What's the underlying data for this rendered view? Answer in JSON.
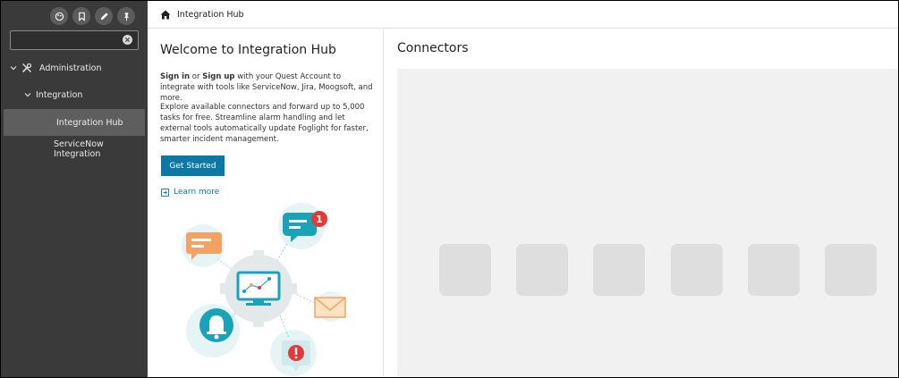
{
  "sidebar": {
    "icons": [
      "palette-icon",
      "bookmark-icon",
      "pencil-icon",
      "pin-icon"
    ],
    "search": {
      "value": "",
      "placeholder": ""
    },
    "nav": {
      "administration": "Administration",
      "integration": "Integration",
      "integration_hub": "Integration Hub",
      "servicenow": "ServiceNow Integration"
    }
  },
  "breadcrumb": {
    "label": "Integration Hub"
  },
  "welcome": {
    "title": "Welcome to Integration Hub",
    "sign_in": "Sign in",
    "or": " or ",
    "sign_up": "Sign up",
    "p1_rest": " with your Quest Account to integrate with tools like ServiceNow, Jira, Moogsoft, and more.",
    "p2": "Explore available connectors and forward up to 5,000 tasks for free. Streamline alarm handling and let external tools automatically update Foglight for faster, smarter incident management.",
    "button": "Get Started",
    "learn_more": "Learn more",
    "notification_count": "1"
  },
  "connectors": {
    "title": "Connectors"
  },
  "colors": {
    "sidebar_bg": "#3a3a3a",
    "selected_bg": "#5e5e5e",
    "accent": "#0b78a5",
    "chat_orange": "#f4a261",
    "chat_teal": "#1aa3b8",
    "alert_red": "#e03a3a"
  }
}
